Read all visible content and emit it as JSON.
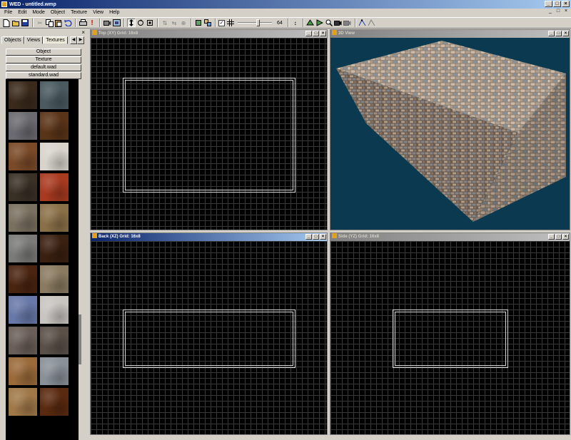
{
  "window": {
    "title": "WED - untitled.wmp",
    "controls": [
      "_",
      "□",
      "×"
    ]
  },
  "menu": [
    "File",
    "Edit",
    "Mode",
    "Object",
    "Texture",
    "View",
    "Help"
  ],
  "menu_controls": [
    "_",
    "□",
    "×"
  ],
  "toolbar": {
    "grid_value": "64",
    "checkbox_mark": "✓"
  },
  "left_panel": {
    "close": "×",
    "tabs": [
      "Objects",
      "Views",
      "Textures"
    ],
    "active_tab": "Textures",
    "tab_arrows": [
      "◀",
      "▶"
    ],
    "categories": [
      "Object",
      "Texture",
      "default.wad",
      "standard.wad"
    ]
  },
  "textures": [
    "#3b2a1c",
    "#4a5a60",
    "#6a6a70",
    "#5a3418",
    "#7a4a28",
    "#d8d4cc",
    "#3a3026",
    "#a83a20",
    "#7a7060",
    "#8a7048",
    "#7a7a78",
    "#3a2010",
    "#4a2410",
    "#8a7a60",
    "#6878a8",
    "#c8c4c0",
    "#6a5e58",
    "#5a5048",
    "#9a6a3a",
    "#8a9098",
    "#a07848",
    "#5a2a10"
  ],
  "viewports": {
    "top": {
      "title": "Top (XY) Grid: 16x8"
    },
    "view3d": {
      "title": "3D View"
    },
    "back": {
      "title": "Back (XZ) Grid: 16x8"
    },
    "side": {
      "title": "Side (YZ) Grid: 16x8"
    },
    "buttons": [
      "_",
      "□",
      "×"
    ]
  },
  "colors": {
    "active_title": "#0a246a",
    "viewport_bg": "#000000",
    "view3d_bg": "#0b3a50",
    "wireframe": "#d8d8d8"
  }
}
